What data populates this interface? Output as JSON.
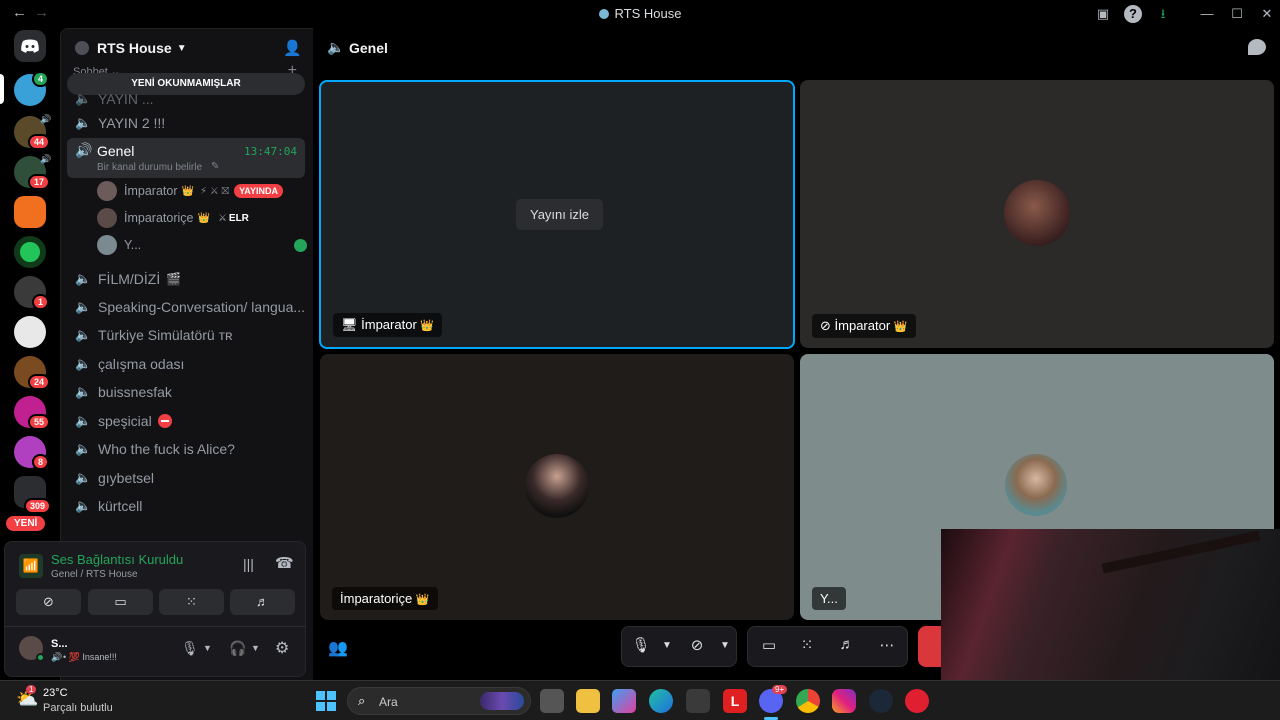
{
  "titlebar": {
    "back": "←",
    "forward": "→",
    "title": "RTS House",
    "minimize": "—",
    "maximize": "☐",
    "close": "✕"
  },
  "rail": {
    "badges": [
      "44",
      "17",
      "1",
      "24",
      "55",
      "8",
      "309"
    ],
    "new_label": "YENİ"
  },
  "guild": {
    "name": "RTS House",
    "category_label": "Sohbet",
    "unread_banner": "YENİ OKUNMAMIŞLAR",
    "channels_top": [
      "YAYIN ...",
      "YAYIN 2 !!!"
    ],
    "active_channel": {
      "name": "Genel",
      "timer": "13:47:04",
      "status": "Bir kanal durumu belirle"
    },
    "voice_users": [
      {
        "name": "İmparator",
        "badge": "YAYINDA"
      },
      {
        "name": "İmparatoriçe",
        "tag": "ELR"
      },
      {
        "name": "Y..."
      }
    ],
    "channels_bottom": [
      "FİLM/DİZİ",
      "Speaking-Conversation/ langua...",
      "Türkiye Simülatörü ᴛʀ",
      "çalışma odası",
      "buissnesfak",
      "speşicial",
      "Who the fuck is Alice?",
      "gıybetsel",
      "kürtcell"
    ]
  },
  "voice_panel": {
    "status": "Ses Bağlantısı Kuruldu",
    "location": "Genel / RTS House",
    "user_name": "S...",
    "user_status": "• 💯 Insane!!!"
  },
  "main": {
    "channel_title": "Genel",
    "watch_stream": "Yayını izle",
    "tiles": {
      "stream_name": "İmparator",
      "camera_name": "İmparator",
      "empress_name": "İmparatoriçe",
      "y_name": "Y..."
    }
  },
  "taskbar": {
    "temperature": "23°C",
    "weather": "Parçalı bulutlu",
    "weather_badge": "1",
    "search_placeholder": "Ara",
    "discord_badge": "9+"
  },
  "colors": {
    "accent_green": "#23a55a",
    "live_red": "#f23f43",
    "stream_border": "#00a8fc",
    "blurple": "#5865f2"
  }
}
